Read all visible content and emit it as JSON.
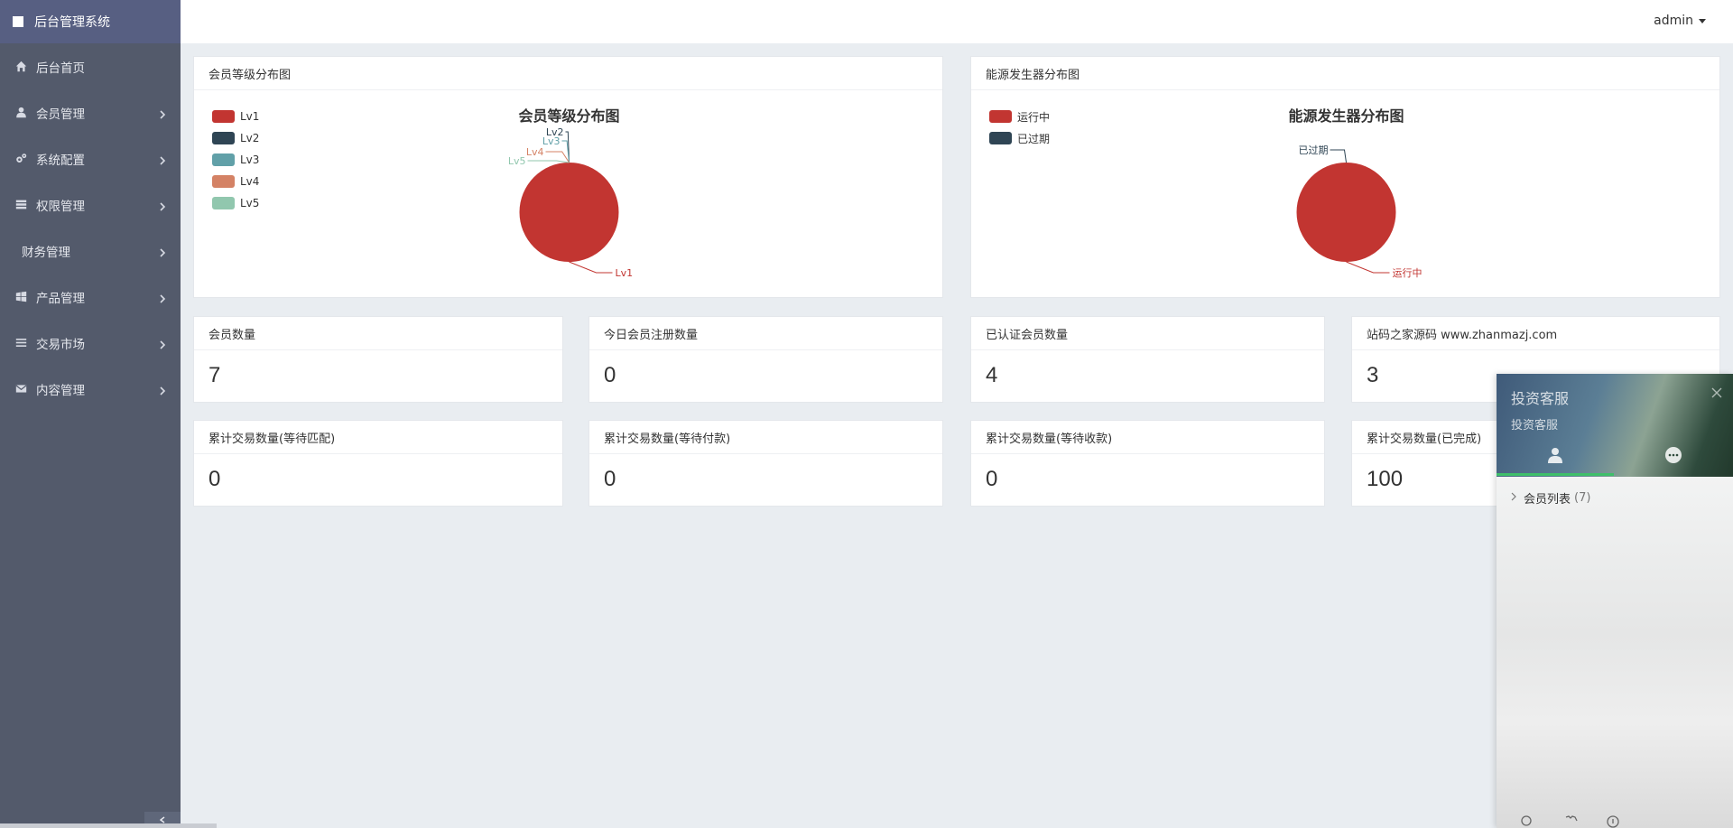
{
  "sidebar": {
    "brand": "后台管理系统",
    "items": [
      {
        "label": "后台首页",
        "icon": "home-icon",
        "has_children": false
      },
      {
        "label": "会员管理",
        "icon": "user-icon",
        "has_children": true
      },
      {
        "label": "系统配置",
        "icon": "cogs-icon",
        "has_children": true
      },
      {
        "label": "权限管理",
        "icon": "server-icon",
        "has_children": true
      },
      {
        "label": "财务管理",
        "icon": "",
        "has_children": true
      },
      {
        "label": "产品管理",
        "icon": "windows-icon",
        "has_children": true
      },
      {
        "label": "交易市场",
        "icon": "list-icon",
        "has_children": true
      },
      {
        "label": "内容管理",
        "icon": "envelope-icon",
        "has_children": true
      }
    ]
  },
  "topbar": {
    "user": "admin"
  },
  "charts": {
    "member": {
      "panel_title": "会员等级分布图",
      "chart_data": {
        "type": "pie",
        "title": "会员等级分布图",
        "categories": [
          "Lv1",
          "Lv2",
          "Lv3",
          "Lv4",
          "Lv5"
        ],
        "values": [
          7,
          0,
          0,
          0,
          0
        ],
        "colors": [
          "#c23531",
          "#2f4554",
          "#61a0a8",
          "#d48265",
          "#91c7ae"
        ],
        "legend_position": "top-left"
      }
    },
    "energy": {
      "panel_title": "能源发生器分布图",
      "chart_data": {
        "type": "pie",
        "title": "能源发生器分布图",
        "categories": [
          "运行中",
          "已过期"
        ],
        "values": [
          1,
          0
        ],
        "colors": [
          "#c23531",
          "#2f4554"
        ],
        "legend_position": "top-left"
      }
    }
  },
  "stats": [
    {
      "label": "会员数量",
      "value": "7"
    },
    {
      "label": "今日会员注册数量",
      "value": "0"
    },
    {
      "label": "已认证会员数量",
      "value": "4"
    },
    {
      "label": "站码之家源码 www.zhanmazj.com",
      "value": "3"
    },
    {
      "label": "累计交易数量(等待匹配)",
      "value": "0"
    },
    {
      "label": "累计交易数量(等待付款)",
      "value": "0"
    },
    {
      "label": "累计交易数量(等待收款)",
      "value": "0"
    },
    {
      "label": "累计交易数量(已完成)",
      "value": "100"
    }
  ],
  "chat": {
    "title": "投资客服",
    "subtitle": "投资客服",
    "list_label": "会员列表",
    "list_count": "(7)",
    "accent": "#3fbf6a"
  }
}
